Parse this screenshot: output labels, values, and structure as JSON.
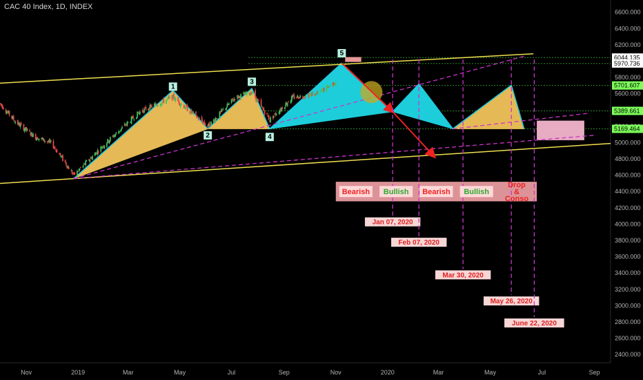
{
  "header": {
    "title": "CAC 40 Index, 1D, INDEX"
  },
  "chart_data": {
    "type": "candlestick",
    "title": "CAC 40 Index, 1D, INDEX",
    "y_ticks": [
      6600,
      6400,
      6200,
      6000,
      5800,
      5600,
      5400,
      5200,
      5000,
      4800,
      4600,
      4400,
      4200,
      4000,
      3800,
      3600,
      3400,
      3200,
      3000,
      2800,
      2600,
      2400
    ],
    "y_tick_labels": [
      "6600.000",
      "6400.000",
      "6200.000",
      "6000.000",
      "5800.000",
      "5600.000",
      "5400.000",
      "5200.000",
      "5000.000",
      "4800.000",
      "4600.000",
      "4400.000",
      "4200.000",
      "4000.000",
      "3800.000",
      "3600.000",
      "3400.000",
      "3200.000",
      "3000.000",
      "2800.000",
      "2600.000",
      "2400.000"
    ],
    "ylim": [
      2300,
      6750
    ],
    "x_ticks": [
      {
        "date": "2018-11-01",
        "label": "Nov"
      },
      {
        "date": "2019-01-01",
        "label": "2019"
      },
      {
        "date": "2019-03-01",
        "label": "Mar"
      },
      {
        "date": "2019-05-01",
        "label": "May"
      },
      {
        "date": "2019-07-01",
        "label": "Jul"
      },
      {
        "date": "2019-09-01",
        "label": "Sep"
      },
      {
        "date": "2019-11-01",
        "label": "Nov"
      },
      {
        "date": "2020-01-01",
        "label": "2020"
      },
      {
        "date": "2020-03-01",
        "label": "Mar"
      },
      {
        "date": "2020-05-01",
        "label": "May"
      },
      {
        "date": "2020-07-01",
        "label": "Jul"
      },
      {
        "date": "2020-09-01",
        "label": "Sep"
      }
    ],
    "xlim": [
      "2018-10-01",
      "2020-09-20"
    ],
    "price_path": [
      [
        "2018-10-01",
        5480
      ],
      [
        "2018-10-20",
        5250
      ],
      [
        "2018-11-10",
        5080
      ],
      [
        "2018-12-01",
        4990
      ],
      [
        "2018-12-27",
        4600
      ],
      [
        "2019-02-01",
        4980
      ],
      [
        "2019-03-15",
        5380
      ],
      [
        "2019-04-23",
        5560
      ],
      [
        "2019-06-03",
        5200
      ],
      [
        "2019-07-05",
        5550
      ],
      [
        "2019-07-25",
        5620
      ],
      [
        "2019-08-15",
        5280
      ],
      [
        "2019-09-10",
        5550
      ],
      [
        "2019-10-10",
        5600
      ],
      [
        "2019-11-01",
        5750
      ]
    ],
    "price_levels": [
      {
        "value": 6044.135,
        "label": "6044.135",
        "color": "#ffffff",
        "line_color": "#2e8b2e"
      },
      {
        "value": 5970.736,
        "label": "5970.736",
        "color": "#ffffff",
        "line_color": "#2e8b2e"
      },
      {
        "value": 5701.607,
        "label": "5701.607",
        "color": "#7dff5a",
        "line_color": "#2e8b2e"
      },
      {
        "value": 5389.661,
        "label": "5389.661",
        "color": "#7dff5a",
        "line_color": "#2e8b2e"
      },
      {
        "value": 5169.464,
        "label": "5169.464",
        "color": "#7dff5a",
        "line_color": "#2e8b2e"
      }
    ],
    "channel_lines": [
      {
        "from": [
          "2018-10-01",
          5730
        ],
        "to": [
          "2020-06-21",
          6090
        ],
        "color": "#f0e050"
      },
      {
        "from": [
          "2018-10-01",
          4500
        ],
        "to": [
          "2020-09-20",
          4990
        ],
        "color": "#f0e050"
      }
    ],
    "dashed_lines": [
      {
        "from": [
          "2018-12-27",
          4560
        ],
        "to": [
          "2020-09-01",
          5090
        ],
        "color": "#cc33cc"
      },
      {
        "from": [
          "2018-12-27",
          4560
        ],
        "to": [
          "2020-06-10",
          6060
        ],
        "color": "#cc33cc"
      },
      {
        "from": [
          "2020-03-18",
          5169
        ],
        "to": [
          "2020-08-25",
          5360
        ],
        "color": "#cc33cc"
      }
    ],
    "waves": [
      {
        "label": "1",
        "date": "2019-04-23",
        "value": 5560
      },
      {
        "label": "2",
        "date": "2019-06-03",
        "value": 5200
      },
      {
        "label": "3",
        "date": "2019-07-25",
        "value": 5620
      },
      {
        "label": "4",
        "date": "2019-08-15",
        "value": 5180
      },
      {
        "label": "5",
        "date": "2019-11-08",
        "value": 5970
      }
    ],
    "triangles": [
      {
        "color": "#f2c35a",
        "points": [
          [
            "2018-12-27",
            4560
          ],
          [
            "2019-04-23",
            5640
          ],
          [
            "2019-06-03",
            5170
          ]
        ]
      },
      {
        "color": "#f2c35a",
        "points": [
          [
            "2019-06-03",
            5170
          ],
          [
            "2019-07-25",
            5665
          ],
          [
            "2019-08-15",
            5170
          ]
        ]
      },
      {
        "color": "#1fd8e6",
        "points": [
          [
            "2019-08-15",
            5170
          ],
          [
            "2019-11-08",
            5975
          ],
          [
            "2020-01-07",
            5380
          ]
        ]
      },
      {
        "color": "#1fd8e6",
        "points": [
          [
            "2020-01-07",
            5380
          ],
          [
            "2020-02-07",
            5720
          ],
          [
            "2020-03-18",
            5170
          ]
        ]
      },
      {
        "color": "#f2c35a",
        "points": [
          [
            "2020-03-18",
            5170
          ],
          [
            "2020-05-26",
            5705
          ],
          [
            "2020-06-10",
            5170
          ]
        ]
      }
    ],
    "projection_arrows": [
      {
        "from": [
          "2019-11-08",
          5975
        ],
        "to": [
          "2020-01-07",
          5380
        ],
        "color": "#ee2222"
      },
      {
        "from": [
          "2020-01-07",
          5380
        ],
        "to": [
          "2020-02-25",
          4830
        ],
        "color": "#ee2222"
      }
    ],
    "vertical_dates": [
      {
        "date": "2020-01-07",
        "label": "Jan 07, 2020",
        "bottom": 4100
      },
      {
        "date": "2020-02-07",
        "label": "Feb 07, 2020",
        "bottom": 3850
      },
      {
        "date": "2020-03-30",
        "label": "Mar 30, 2020",
        "bottom": 3450
      },
      {
        "date": "2020-05-26",
        "label": "May 26, 2020",
        "bottom": 3130
      },
      {
        "date": "2020-06-22",
        "label": "June 22, 2020",
        "bottom": 2860
      }
    ],
    "phases": [
      {
        "label": "Bearish",
        "color": "#ee2222"
      },
      {
        "label": "Bullish",
        "color": "#2ea82e"
      },
      {
        "label": "Bearish",
        "color": "#ee2222"
      },
      {
        "label": "Bullish",
        "color": "#2ea82e"
      },
      {
        "label": "Drop & Conso",
        "color": "#ee2222"
      }
    ],
    "phase_band": {
      "from": "2019-11-01",
      "to": "2020-06-25",
      "high": 4520,
      "low": 4280
    },
    "boxes": [
      {
        "from": [
          "2019-11-12",
          6050
        ],
        "to": [
          "2019-12-01",
          5990
        ],
        "color": "#f6a0a0"
      },
      {
        "from": [
          "2020-06-25",
          5270
        ],
        "to": [
          "2020-08-20",
          5030
        ],
        "color": "#f3b5cc"
      }
    ],
    "circle": {
      "date": "2019-12-13",
      "value": 5620,
      "color": "#c9a820"
    }
  }
}
